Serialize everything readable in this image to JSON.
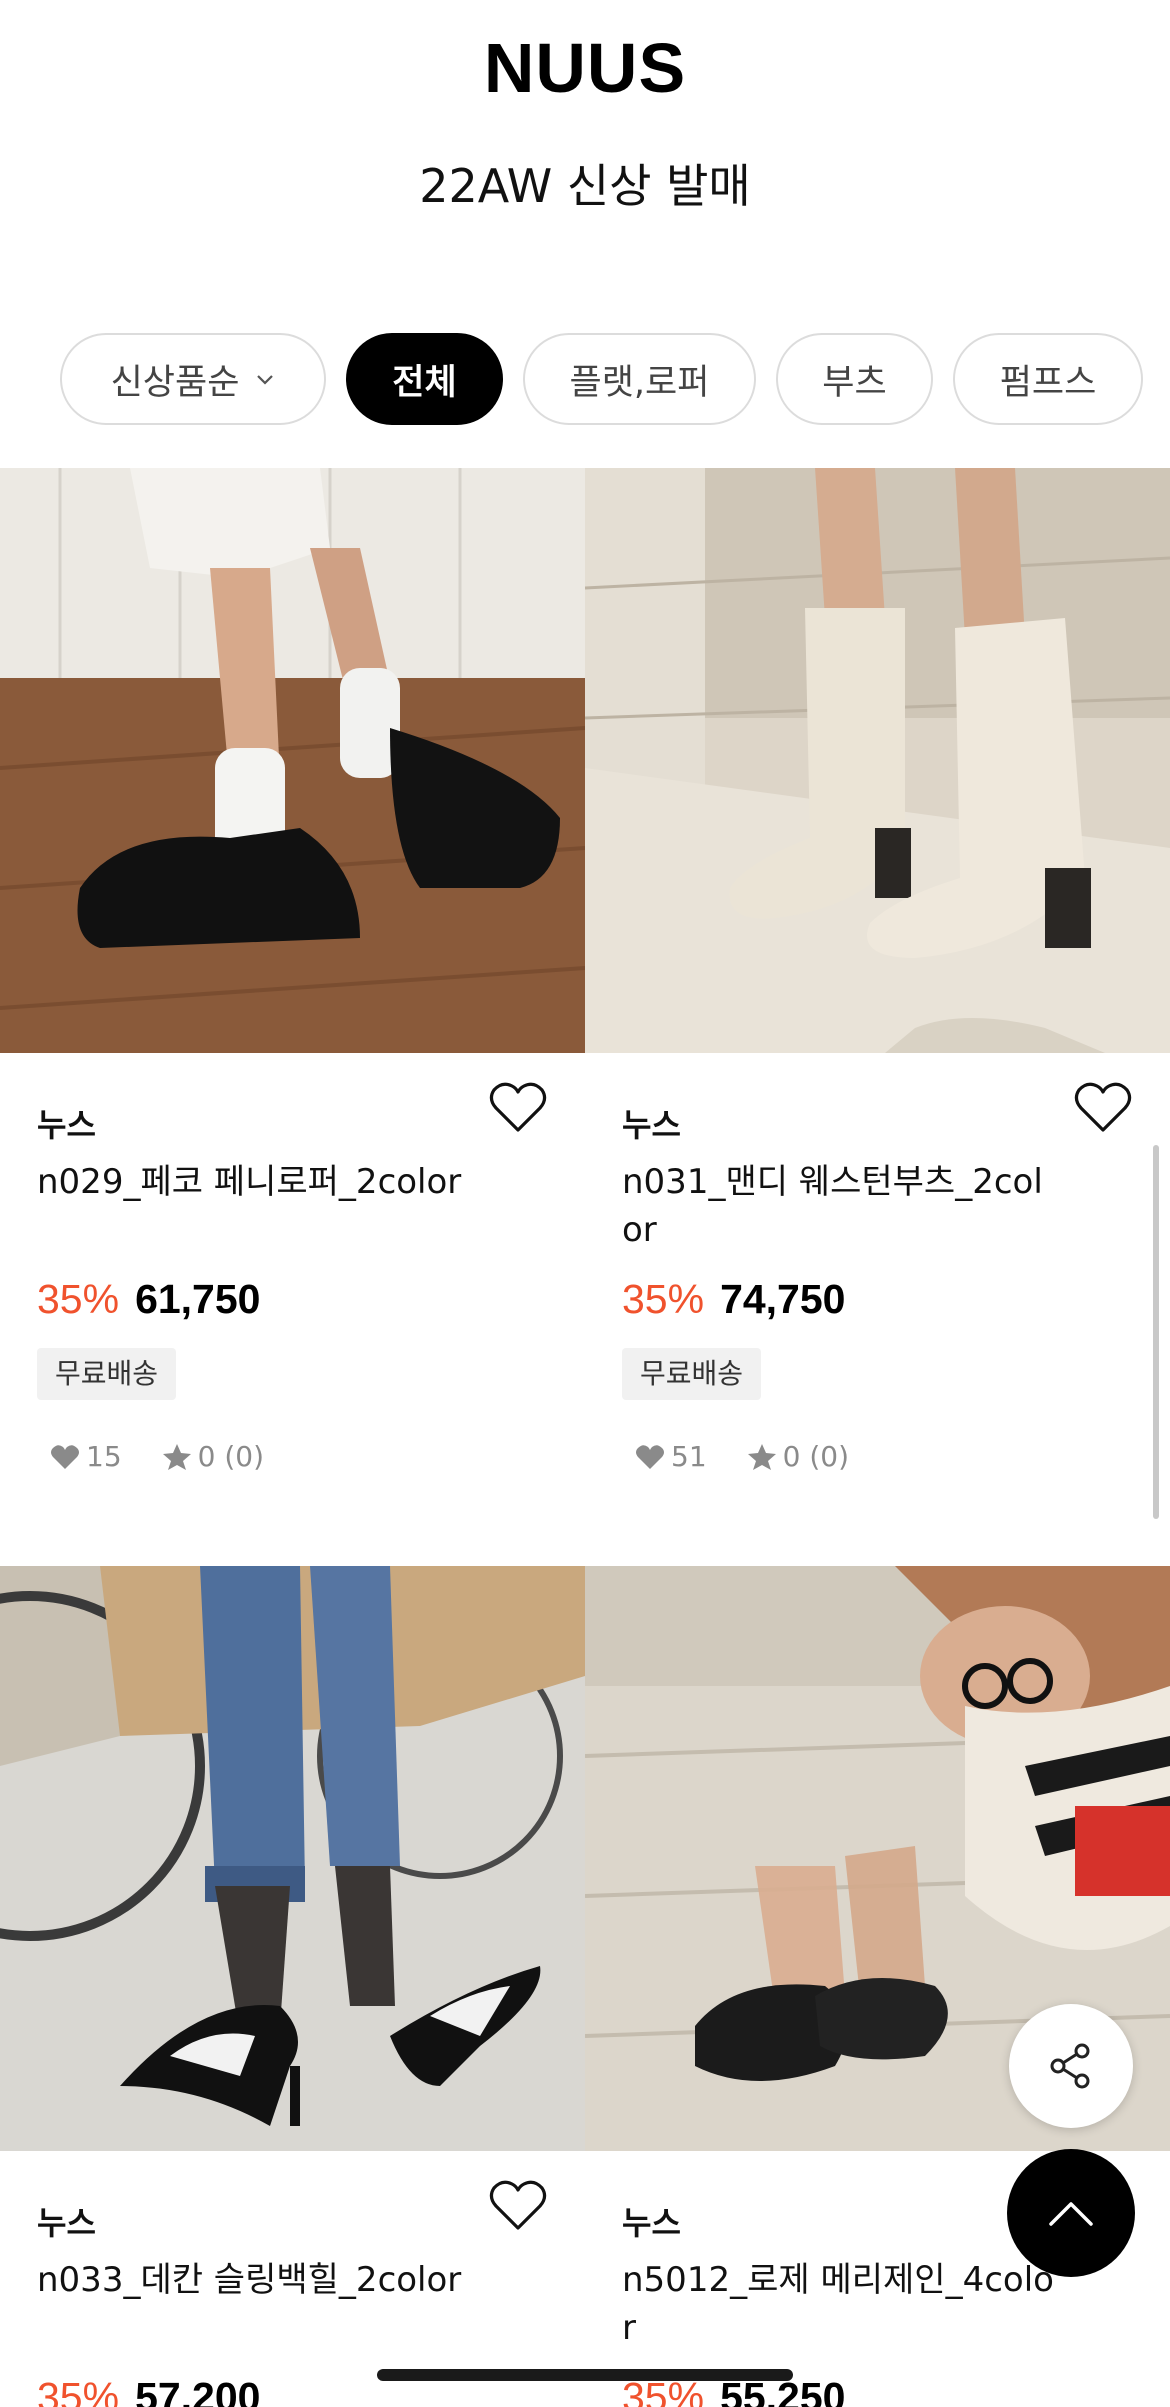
{
  "header": {
    "brand": "NUUS",
    "subtitle": "22AW 신상 발매"
  },
  "filters": {
    "sort_label": "신상품순",
    "categories": [
      "전체",
      "플랫,로퍼",
      "부츠",
      "펌프스"
    ],
    "active_category": "전체"
  },
  "products": [
    {
      "brand": "누스",
      "name": "n029_페코 페니로퍼_2color",
      "discount": "35%",
      "price": "61,750",
      "badge": "무료배송",
      "likes": "15",
      "rating": "0 (0)",
      "icon": "penny-loafer-photo"
    },
    {
      "brand": "누스",
      "name": "n031_맨디 웨스턴부츠_2color",
      "discount": "35%",
      "price": "74,750",
      "badge": "무료배송",
      "likes": "51",
      "rating": "0 (0)",
      "icon": "western-boots-photo"
    },
    {
      "brand": "누스",
      "name": "n033_데칸 슬링백힐_2color",
      "discount": "35%",
      "price": "57,200",
      "icon": "slingback-heel-photo"
    },
    {
      "brand": "누스",
      "name": "n5012_로제 메리제인_4color",
      "discount": "35%",
      "price": "55,250",
      "icon": "mary-jane-photo"
    }
  ],
  "colors": {
    "discount": "#f0522d",
    "active_chip": "#000000",
    "badge_bg": "#f1f1f1"
  },
  "floating": {
    "share_icon": "share-icon",
    "top_icon": "chevron-up-icon"
  }
}
